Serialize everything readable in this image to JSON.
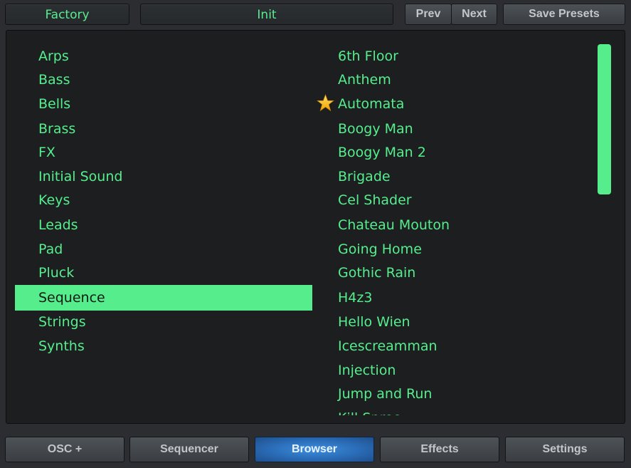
{
  "header": {
    "bank_value": "Factory",
    "preset_value": "Init",
    "prev_label": "Prev",
    "next_label": "Next",
    "save_label": "Save Presets"
  },
  "categories": {
    "items": [
      "Arps",
      "Bass",
      "Bells",
      "Brass",
      "FX",
      "Initial Sound",
      "Keys",
      "Leads",
      "Pad",
      "Pluck",
      "Sequence",
      "Strings",
      "Synths"
    ],
    "selected": "Sequence"
  },
  "presets": {
    "items": [
      "6th Floor",
      "Anthem",
      "Automata",
      "Boogy Man",
      "Boogy Man 2",
      "Brigade",
      "Cel Shader",
      "Chateau Mouton",
      "Going Home",
      "Gothic Rain",
      "H4z3",
      "Hello Wien",
      "Icescreamman",
      "Injection",
      "Jump and Run",
      "Kill Spree"
    ],
    "favorite": "Automata"
  },
  "tabs": {
    "items": [
      "OSC +",
      "Sequencer",
      "Browser",
      "Effects",
      "Settings"
    ],
    "active": "Browser"
  },
  "colors": {
    "accent": "#56ee8d",
    "active_tab": "#2f76c8",
    "panel_bg": "#1c1e20",
    "body_bg": "#2b2d30",
    "favorite_star": "#f5b400"
  },
  "icons": {
    "favorite": "star-icon"
  }
}
